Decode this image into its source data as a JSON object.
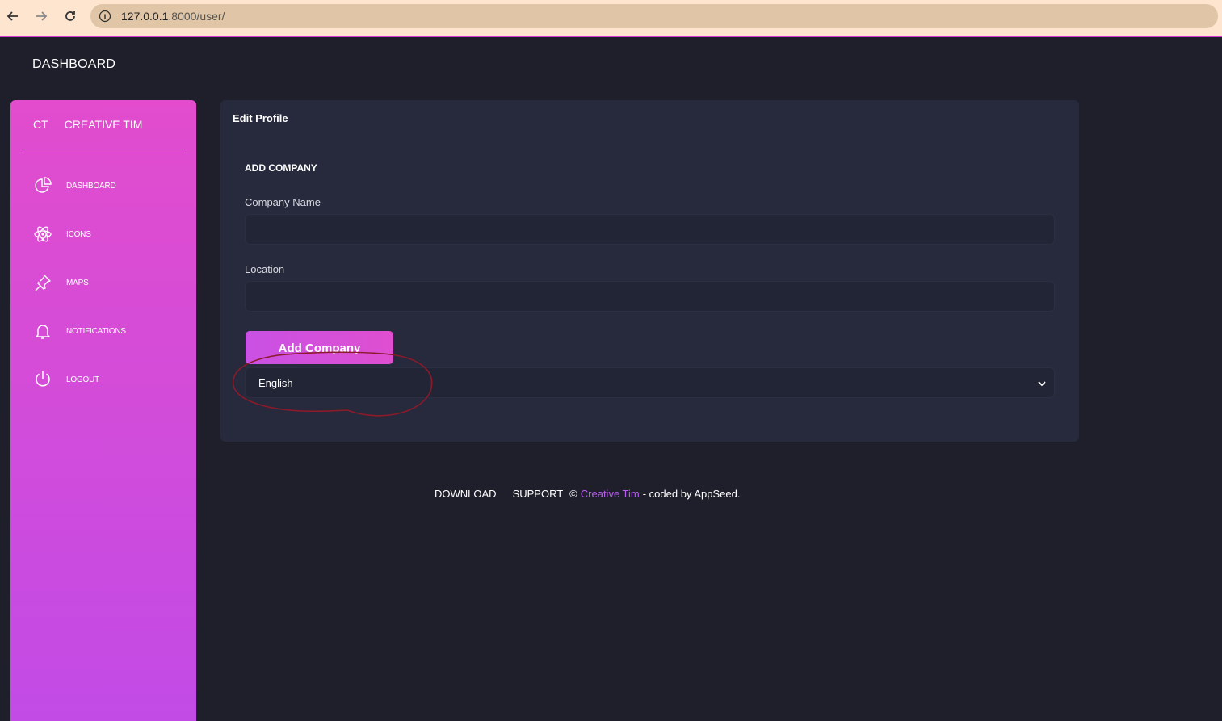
{
  "browser": {
    "url_host": "127.0.0.1",
    "url_path": ":8000/user/"
  },
  "navbar": {
    "title": "DASHBOARD"
  },
  "sidebar": {
    "brand_short": "CT",
    "brand_name": "CREATIVE TIM",
    "items": [
      {
        "label": "DASHBOARD",
        "icon": "chart-pie-icon"
      },
      {
        "label": "ICONS",
        "icon": "atom-icon"
      },
      {
        "label": "MAPS",
        "icon": "pin-icon"
      },
      {
        "label": "NOTIFICATIONS",
        "icon": "bell-icon"
      },
      {
        "label": "LOGOUT",
        "icon": "power-icon"
      }
    ],
    "gradient_top": "#e24ccd",
    "gradient_bottom": "#c24be6"
  },
  "card": {
    "title": "Edit Profile",
    "section_title": "ADD COMPANY",
    "company_name_label": "Company Name",
    "company_name_value": "",
    "location_label": "Location",
    "location_value": "",
    "add_button": "Add Company",
    "language_selected": "English"
  },
  "footer": {
    "download": "DOWNLOAD",
    "support": "SUPPORT",
    "copyright": "©",
    "brand": "Creative Tim",
    "suffix": "- coded by AppSeed."
  },
  "colors": {
    "background": "#1e1f2a",
    "card": "#272a3d",
    "accent": "#d64fd6",
    "link": "#b85df0",
    "annotation": "#8b1a2a"
  }
}
